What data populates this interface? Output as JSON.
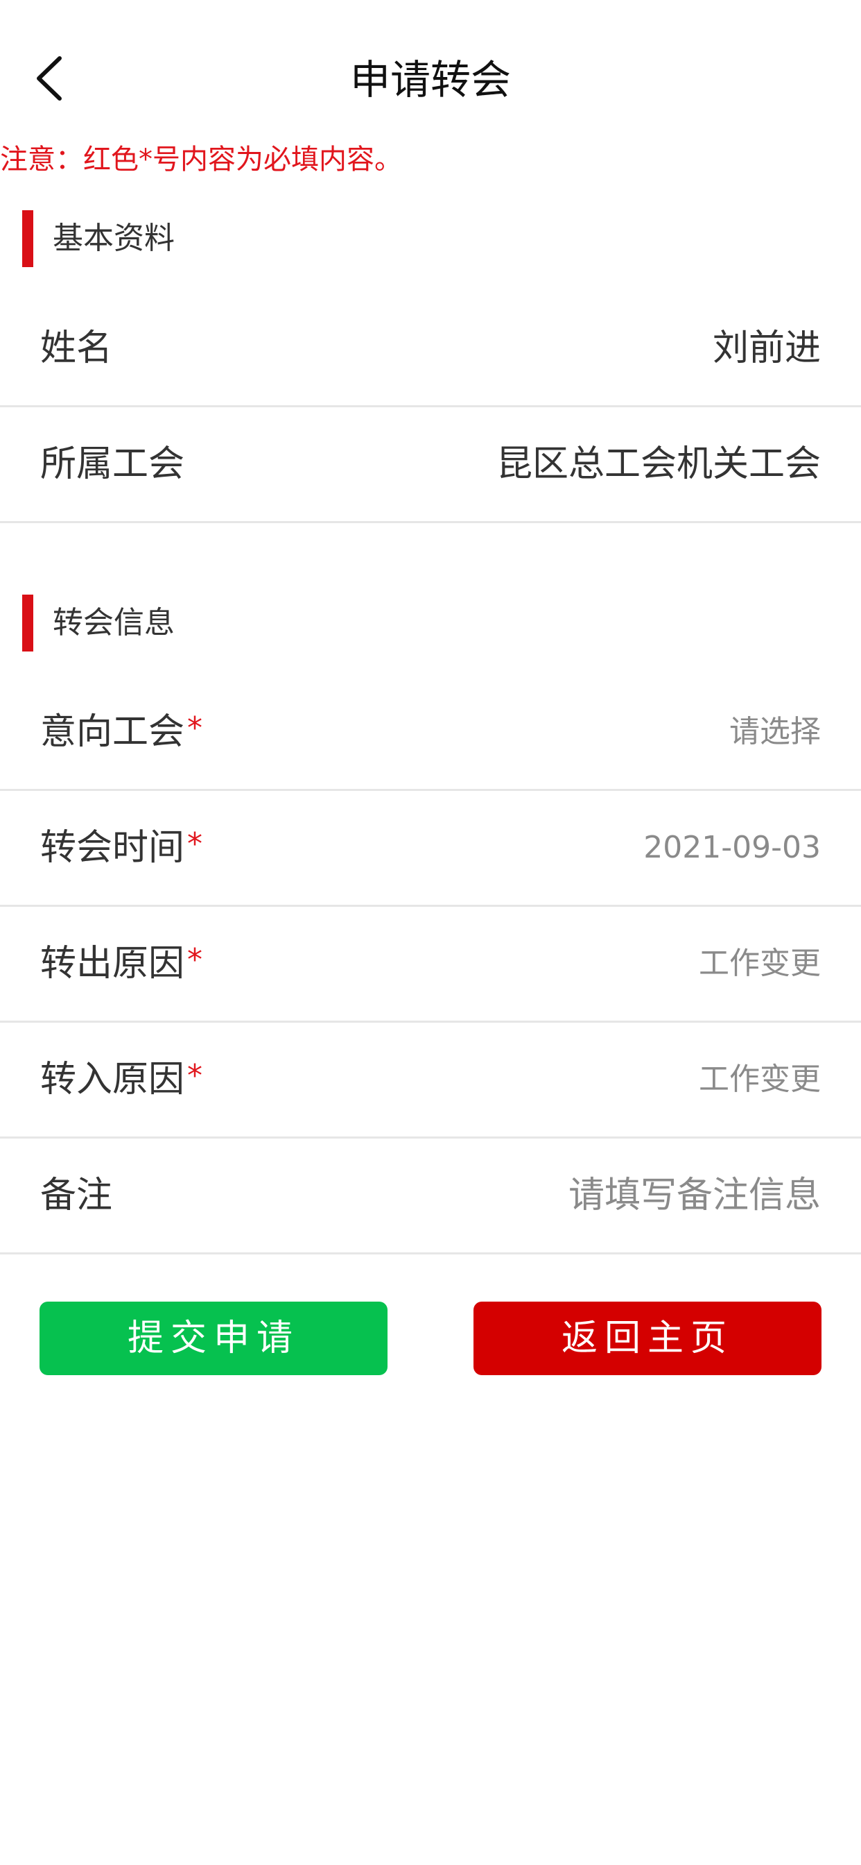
{
  "header": {
    "title": "申请转会",
    "back_icon": "chevron-left-icon"
  },
  "notice": "注意：红色*号内容为必填内容。",
  "colors": {
    "accent_red": "#d90f16",
    "required_red": "#e1161d",
    "submit_green": "#06c14f",
    "home_red": "#d40000"
  },
  "basic_section": {
    "title": "基本资料",
    "rows": [
      {
        "label": "姓名",
        "value": "刘前进"
      },
      {
        "label": "所属工会",
        "value": "昆区总工会机关工会"
      }
    ]
  },
  "transfer_section": {
    "title": "转会信息",
    "required_mark": "*",
    "rows": [
      {
        "label": "意向工会",
        "value": "请选择"
      },
      {
        "label": "转会时间",
        "value": "2021-09-03"
      },
      {
        "label": "转出原因",
        "value": "工作变更"
      },
      {
        "label": "转入原因",
        "value": "工作变更"
      }
    ],
    "remark": {
      "label": "备注",
      "placeholder": "请填写备注信息",
      "value": ""
    }
  },
  "buttons": {
    "submit": "提交申请",
    "home": "返回主页"
  }
}
